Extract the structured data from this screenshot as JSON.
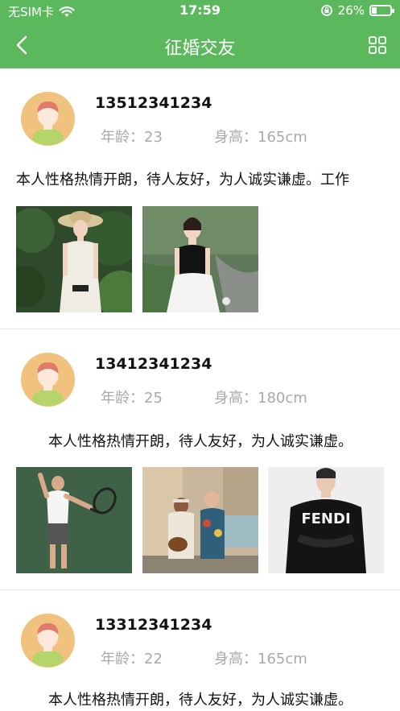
{
  "status_bar": {
    "carrier": "无SIM卡",
    "time": "17:59",
    "battery": "26%",
    "battery_level": 0.26
  },
  "nav": {
    "title": "征婚交友",
    "back_icon": "chevron-left-icon",
    "menu_icon": "grid-icon"
  },
  "colors": {
    "primary": "#5cb85c",
    "meta_text": "#a9a9a9",
    "avatar_bg": "#f1c27d",
    "avatar_hair": "#e07a6b",
    "avatar_body": "#b5d56a"
  },
  "profiles": [
    {
      "phone": "13512341234",
      "age_label": "年龄：",
      "age": "23",
      "height_label": "身高：",
      "height": "165cm",
      "description": "本人性格热情开朗，待人友好，为人诚实谦虚。工作",
      "photos": [
        "photo-woman-straw-hat",
        "photo-woman-black-top"
      ]
    },
    {
      "phone": "13412341234",
      "age_label": "年龄：",
      "age": "25",
      "height_label": "身高：",
      "height": "180cm",
      "description": "本人性格热情开朗，待人友好，为人诚实谦虚。",
      "photos": [
        "photo-man-tennis",
        "photo-men-guitar",
        "photo-man-fendi-sweater"
      ]
    },
    {
      "phone": "13312341234",
      "age_label": "年龄：",
      "age": "22",
      "height_label": "身高：",
      "height": "165cm",
      "description": "本人性格热情开朗，待人友好，为人诚实谦虚。",
      "photos": []
    }
  ]
}
